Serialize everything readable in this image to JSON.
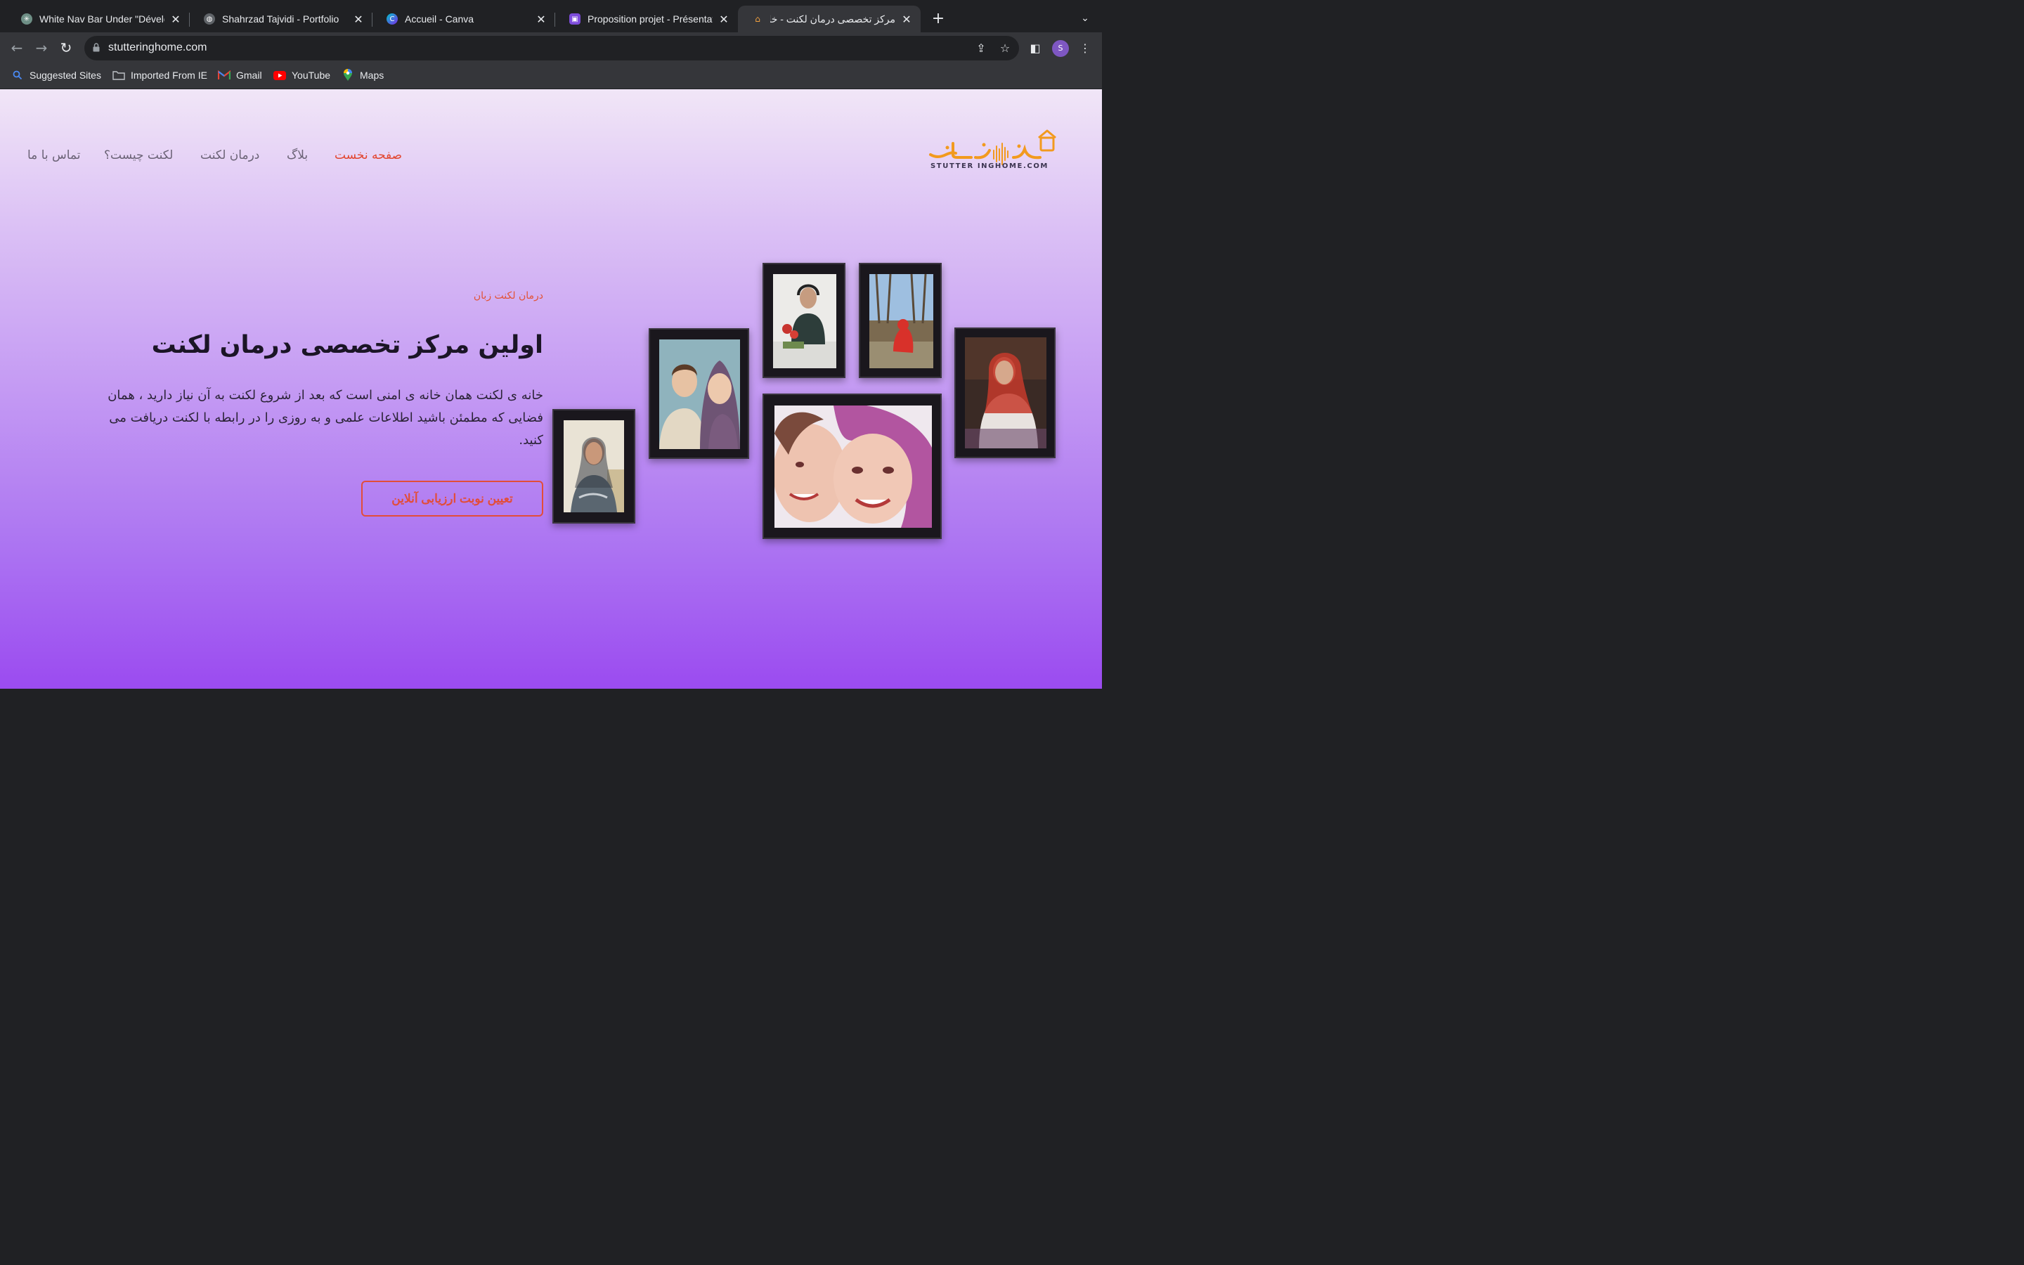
{
  "browser": {
    "tabs": [
      {
        "title": "White Nav Bar Under \"Dévelop",
        "icon": "chatgpt-icon",
        "color": "#10a37f"
      },
      {
        "title": "Shahrzad Tajvidi - Portfolio",
        "icon": "globe-icon",
        "color": "#9aa0a6"
      },
      {
        "title": "Accueil - Canva",
        "icon": "canva-icon",
        "color": "#5b6ce1"
      },
      {
        "title": "Proposition projet - Présentatio",
        "icon": "slides-icon",
        "color": "#7d4cdb"
      },
      {
        "title": "مرکز تخصصی درمان لکنت - خانه لکنت",
        "icon": "stutteringhome-icon",
        "color": "#f0a040"
      }
    ],
    "url": "stutteringhome.com",
    "profile_initial": "S",
    "bookmarks": [
      {
        "label": "Suggested Sites",
        "icon": "search-icon"
      },
      {
        "label": "Imported From IE",
        "icon": "folder-icon"
      },
      {
        "label": "Gmail",
        "icon": "gmail-icon"
      },
      {
        "label": "YouTube",
        "icon": "youtube-icon"
      },
      {
        "label": "Maps",
        "icon": "maps-icon"
      }
    ]
  },
  "site": {
    "logo_text": "STUTTER INGHOME.COM",
    "nav": {
      "home": "صفحه نخست",
      "blog": "بلاگ",
      "treatment": "درمان لکنت",
      "what": "لکنت چیست؟",
      "contact": "تماس با ما"
    },
    "hero": {
      "eyebrow": "درمان لکنت زبان",
      "title": "اولین مرکز تخصصی درمان لکنت",
      "paragraph": "خانه ی لکنت همان خانه ی امنی است که بعد از شروع لکنت به آن نیاز دارید ، همان فضایی که مطمئن باشید اطلاعات علمی و به روزی را در رابطه با لکنت دریافت می کنید.",
      "cta": "تعیین نوبت ارزیابی آنلاین"
    },
    "colors": {
      "accent": "#e2452e",
      "logo_orange": "#f29a1e",
      "gradient_top": "#f1e6f7",
      "gradient_bottom": "#9b4bf0"
    }
  }
}
